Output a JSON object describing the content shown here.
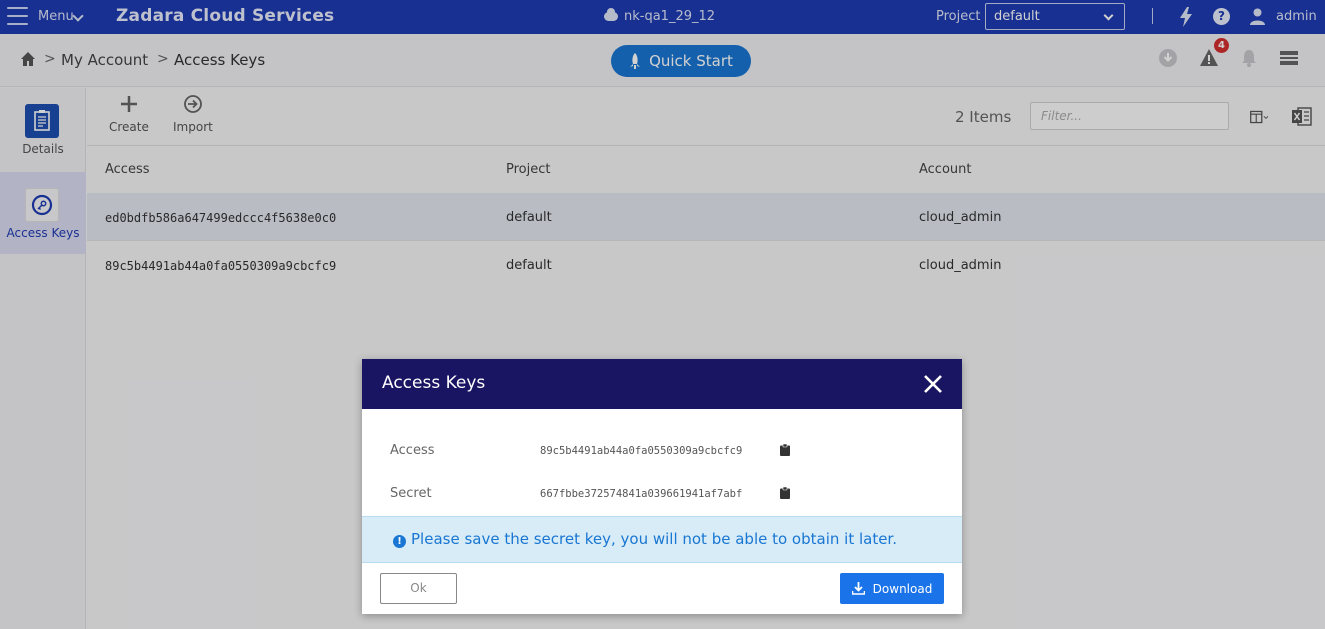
{
  "topbar": {
    "menu_label": "Menu",
    "app_title": "Zadara Cloud Services",
    "environment": "nk-qa1_29_12",
    "project_label": "Project",
    "project_value": "default",
    "user_name": "admin"
  },
  "breadcrumb": {
    "items": [
      "My Account",
      "Access Keys"
    ],
    "separator": ">"
  },
  "quick_start_label": "Quick Start",
  "alerts_badge": "4",
  "sidebar": {
    "items": [
      {
        "label": "Details",
        "icon": "clipboard-icon"
      },
      {
        "label": "Access Keys",
        "icon": "key-icon",
        "active": true
      }
    ]
  },
  "toolbar": {
    "create_label": "Create",
    "import_label": "Import",
    "items_count": "2 Items",
    "filter_placeholder": "Filter..."
  },
  "table": {
    "columns": [
      "Access",
      "Project",
      "Account"
    ],
    "rows": [
      {
        "access": "ed0bdfb586a647499edccc4f5638e0c0",
        "project": "default",
        "account": "cloud_admin"
      },
      {
        "access": "89c5b4491ab44a0fa0550309a9cbcfc9",
        "project": "default",
        "account": "cloud_admin"
      }
    ]
  },
  "modal": {
    "title": "Access Keys",
    "access_label": "Access",
    "access_value": "89c5b4491ab44a0fa0550309a9cbcfc9",
    "secret_label": "Secret",
    "secret_value": "667fbbe372574841a039661941af7abf",
    "alert_text": "Please save the secret key, you will not be able to obtain it later.",
    "ok_label": "Ok",
    "download_label": "Download"
  },
  "colors": {
    "topbar": "#1e3bb3",
    "modal_header": "#1a1563",
    "accent": "#1976d2",
    "alert_bg": "#d7ecf7",
    "badge": "#d32f2f"
  }
}
